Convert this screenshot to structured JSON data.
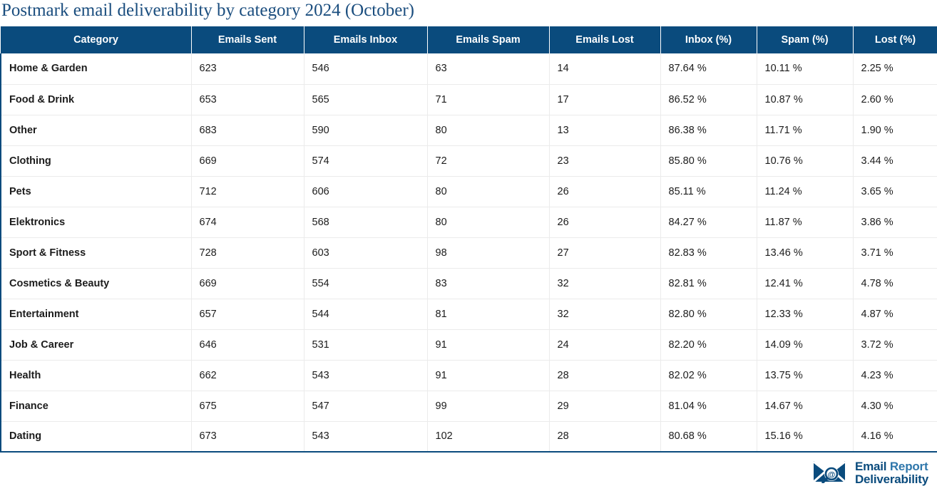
{
  "title": "Postmark email deliverability by category 2024 (October)",
  "theme": {
    "header_bg": "#0a4b7d",
    "header_text": "#ffffff",
    "title_color": "#1a4d7e",
    "border_color": "#0a4b7d",
    "row_divider": "#ebebeb"
  },
  "table": {
    "columns": [
      "Category",
      "Emails Sent",
      "Emails Inbox",
      "Emails Spam",
      "Emails Lost",
      "Inbox (%)",
      "Spam (%)",
      "Lost (%)"
    ],
    "rows": [
      {
        "category": "Home & Garden",
        "sent": "623",
        "inbox": "546",
        "spam": "63",
        "lost": "14",
        "inbox_pct": "87.64 %",
        "spam_pct": "10.11 %",
        "lost_pct": "2.25 %"
      },
      {
        "category": "Food & Drink",
        "sent": "653",
        "inbox": "565",
        "spam": "71",
        "lost": "17",
        "inbox_pct": "86.52 %",
        "spam_pct": "10.87 %",
        "lost_pct": "2.60 %"
      },
      {
        "category": "Other",
        "sent": "683",
        "inbox": "590",
        "spam": "80",
        "lost": "13",
        "inbox_pct": "86.38 %",
        "spam_pct": "11.71 %",
        "lost_pct": "1.90 %"
      },
      {
        "category": "Clothing",
        "sent": "669",
        "inbox": "574",
        "spam": "72",
        "lost": "23",
        "inbox_pct": "85.80 %",
        "spam_pct": "10.76 %",
        "lost_pct": "3.44 %"
      },
      {
        "category": "Pets",
        "sent": "712",
        "inbox": "606",
        "spam": "80",
        "lost": "26",
        "inbox_pct": "85.11 %",
        "spam_pct": "11.24 %",
        "lost_pct": "3.65 %"
      },
      {
        "category": "Elektronics",
        "sent": "674",
        "inbox": "568",
        "spam": "80",
        "lost": "26",
        "inbox_pct": "84.27 %",
        "spam_pct": "11.87 %",
        "lost_pct": "3.86 %"
      },
      {
        "category": "Sport & Fitness",
        "sent": "728",
        "inbox": "603",
        "spam": "98",
        "lost": "27",
        "inbox_pct": "82.83 %",
        "spam_pct": "13.46 %",
        "lost_pct": "3.71 %"
      },
      {
        "category": "Cosmetics & Beauty",
        "sent": "669",
        "inbox": "554",
        "spam": "83",
        "lost": "32",
        "inbox_pct": "82.81 %",
        "spam_pct": "12.41 %",
        "lost_pct": "4.78 %"
      },
      {
        "category": "Entertainment",
        "sent": "657",
        "inbox": "544",
        "spam": "81",
        "lost": "32",
        "inbox_pct": "82.80 %",
        "spam_pct": "12.33 %",
        "lost_pct": "4.87 %"
      },
      {
        "category": "Job & Career",
        "sent": "646",
        "inbox": "531",
        "spam": "91",
        "lost": "24",
        "inbox_pct": "82.20 %",
        "spam_pct": "14.09 %",
        "lost_pct": "3.72 %"
      },
      {
        "category": "Health",
        "sent": "662",
        "inbox": "543",
        "spam": "91",
        "lost": "28",
        "inbox_pct": "82.02 %",
        "spam_pct": "13.75 %",
        "lost_pct": "4.23 %"
      },
      {
        "category": "Finance",
        "sent": "675",
        "inbox": "547",
        "spam": "99",
        "lost": "29",
        "inbox_pct": "81.04 %",
        "spam_pct": "14.67 %",
        "lost_pct": "4.30 %"
      },
      {
        "category": "Dating",
        "sent": "673",
        "inbox": "543",
        "spam": "102",
        "lost": "28",
        "inbox_pct": "80.68 %",
        "spam_pct": "15.16 %",
        "lost_pct": "4.16 %"
      }
    ]
  },
  "footer": {
    "logo_icon": "envelope-magnifier-at-icon",
    "logo_line1_bold": "Email",
    "logo_line1_light": "Report",
    "logo_line2": "Deliverability"
  },
  "chart_data": {
    "type": "table",
    "title": "Postmark email deliverability by category 2024 (October)",
    "columns": [
      "Category",
      "Emails Sent",
      "Emails Inbox",
      "Emails Spam",
      "Emails Lost",
      "Inbox (%)",
      "Spam (%)",
      "Lost (%)"
    ],
    "categories": [
      "Home & Garden",
      "Food & Drink",
      "Other",
      "Clothing",
      "Pets",
      "Elektronics",
      "Sport & Fitness",
      "Cosmetics & Beauty",
      "Entertainment",
      "Job & Career",
      "Health",
      "Finance",
      "Dating"
    ],
    "series": [
      {
        "name": "Emails Sent",
        "values": [
          623,
          653,
          683,
          669,
          712,
          674,
          728,
          669,
          657,
          646,
          662,
          675,
          673
        ]
      },
      {
        "name": "Emails Inbox",
        "values": [
          546,
          565,
          590,
          574,
          606,
          568,
          603,
          554,
          544,
          531,
          543,
          547,
          543
        ]
      },
      {
        "name": "Emails Spam",
        "values": [
          63,
          71,
          80,
          72,
          80,
          80,
          98,
          83,
          81,
          91,
          91,
          99,
          102
        ]
      },
      {
        "name": "Emails Lost",
        "values": [
          14,
          17,
          13,
          23,
          26,
          26,
          27,
          32,
          32,
          24,
          28,
          29,
          28
        ]
      },
      {
        "name": "Inbox (%)",
        "values": [
          87.64,
          86.52,
          86.38,
          85.8,
          85.11,
          84.27,
          82.83,
          82.81,
          82.8,
          82.2,
          82.02,
          81.04,
          80.68
        ]
      },
      {
        "name": "Spam (%)",
        "values": [
          10.11,
          10.87,
          11.71,
          10.76,
          11.24,
          11.87,
          13.46,
          12.41,
          12.33,
          14.09,
          13.75,
          14.67,
          15.16
        ]
      },
      {
        "name": "Lost (%)",
        "values": [
          2.25,
          2.6,
          1.9,
          3.44,
          3.65,
          3.86,
          3.71,
          4.78,
          4.87,
          3.72,
          4.23,
          4.3,
          4.16
        ]
      }
    ],
    "xlabel": "",
    "ylabel": "",
    "grid": true,
    "legend": "none"
  }
}
